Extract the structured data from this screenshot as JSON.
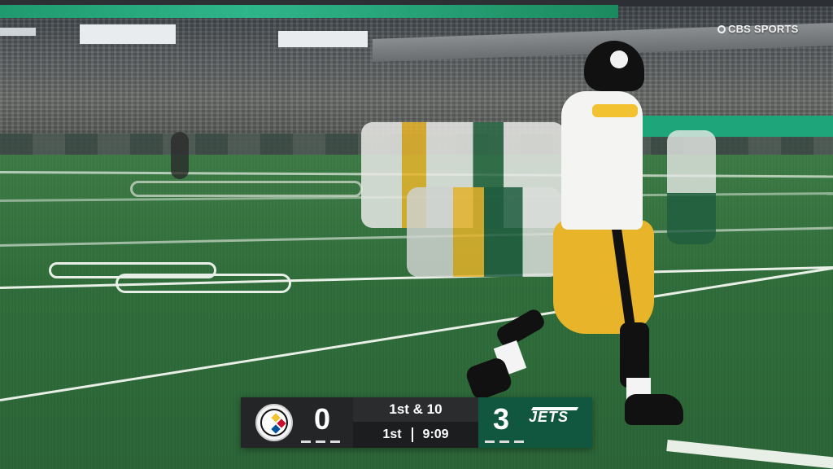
{
  "network": {
    "label": "CBS SPORTS"
  },
  "scorebug": {
    "away": {
      "name": "Steelers",
      "score": "0",
      "color": "#232527",
      "logo": "steelers-logo"
    },
    "home": {
      "name": "JETS",
      "score": "3",
      "color": "#115740",
      "logo": "jets-logo"
    },
    "down_distance": "1st & 10",
    "quarter": "1st",
    "clock": "9:09"
  },
  "colors": {
    "field": "#2f6d3a",
    "steelers_gold": "#f2c230",
    "jets_green": "#115740"
  }
}
